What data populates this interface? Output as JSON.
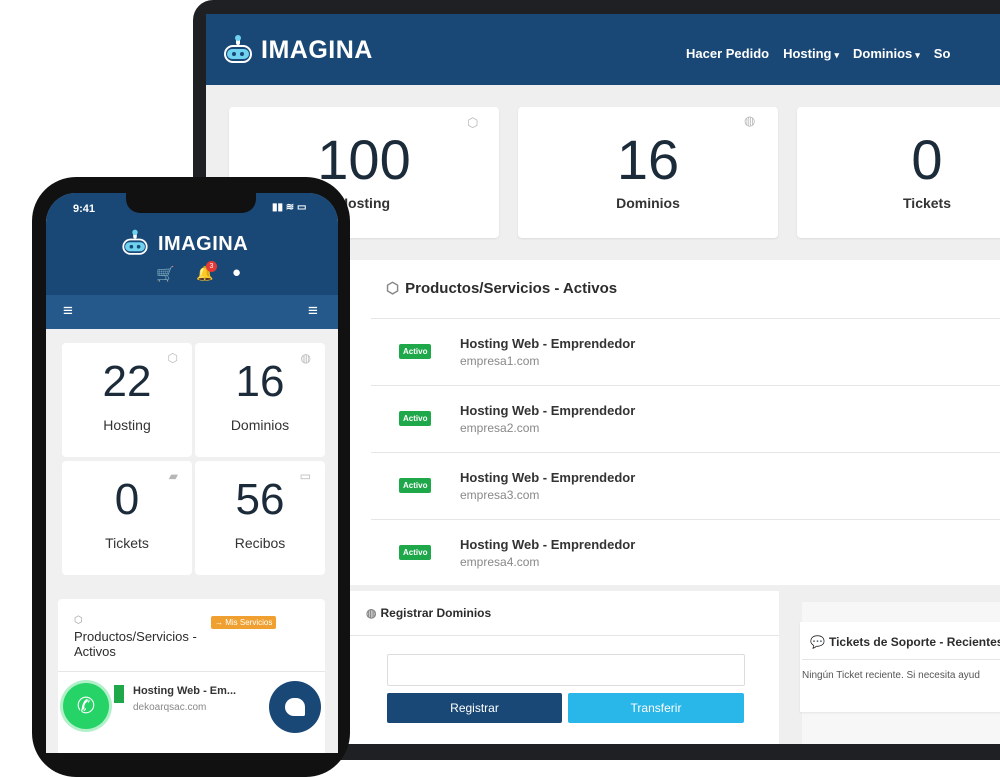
{
  "brand": "IMAGINA",
  "nav": {
    "items": [
      {
        "label": "Hacer Pedido",
        "caret": false
      },
      {
        "label": "Hosting",
        "caret": true
      },
      {
        "label": "Dominios",
        "caret": true
      },
      {
        "label": "So",
        "caret": false
      }
    ]
  },
  "desktop_stats": [
    {
      "value": "100",
      "label": "Hosting",
      "icon": "box-icon"
    },
    {
      "value": "16",
      "label": "Dominios",
      "icon": "globe-icon"
    },
    {
      "value": "0",
      "label": "Tickets",
      "icon": ""
    }
  ],
  "products_panel": {
    "title": "Productos/Servicios - Activos",
    "items": [
      {
        "status": "Activo",
        "name": "Hosting Web - Emprendedor",
        "domain": "empresa1.com"
      },
      {
        "status": "Activo",
        "name": "Hosting Web - Emprendedor",
        "domain": "empresa2.com"
      },
      {
        "status": "Activo",
        "name": "Hosting Web - Emprendedor",
        "domain": "empresa3.com"
      },
      {
        "status": "Activo",
        "name": "Hosting Web - Emprendedor",
        "domain": "empresa4.com"
      }
    ]
  },
  "register_panel": {
    "title": "Registrar Dominios",
    "input_placeholder": "",
    "register_label": "Registrar",
    "transfer_label": "Transferir"
  },
  "tickets_panel": {
    "title": "Tickets de Soporte - Recientes",
    "empty_text": "Ningún Ticket reciente. Si necesita ayud"
  },
  "phone": {
    "time": "9:41",
    "cart_badge": "",
    "bell_badge": "3",
    "stats": [
      {
        "value": "22",
        "label": "Hosting",
        "icon": "box-icon"
      },
      {
        "value": "16",
        "label": "Dominios",
        "icon": "globe-icon"
      },
      {
        "value": "0",
        "label": "Tickets",
        "icon": "chat-icon"
      },
      {
        "value": "56",
        "label": "Recibos",
        "icon": "card-icon"
      }
    ],
    "products_title": "Productos/Servicios - Activos",
    "mis_servicios": "→ Mis Servicios",
    "product": {
      "name": "Hosting Web - Em...",
      "domain": "dekoarqsac.com"
    }
  },
  "colors": {
    "navy": "#1a4876",
    "accent_cyan": "#29b6e8",
    "success": "#1fa84a",
    "whatsapp": "#25d366",
    "orange": "#f0a030"
  }
}
